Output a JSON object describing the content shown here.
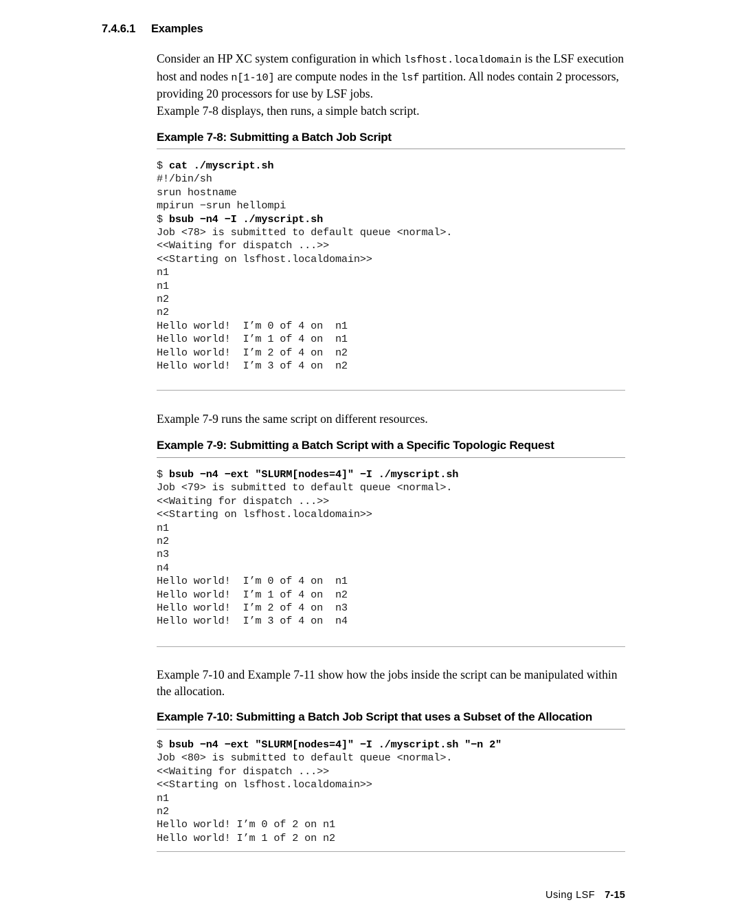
{
  "section": {
    "number": "7.4.6.1",
    "title": "Examples"
  },
  "intro": {
    "paragraph1_part1": "Consider an HP XC system configuration in which ",
    "paragraph1_mono1": "lsfhost.localdomain",
    "paragraph1_part2": " is the LSF execution host and nodes ",
    "paragraph1_mono2": "n[1-10]",
    "paragraph1_part3": " are compute nodes in the ",
    "paragraph1_mono3": "lsf",
    "paragraph1_part4": " partition. All nodes contain 2 processors, providing 20 processors for use by LSF jobs.",
    "paragraph2": "Example 7-8 displays, then runs, a simple batch script."
  },
  "example_7_8": {
    "title": "Example 7-8: Submitting a Batch Job Script",
    "lines": [
      {
        "prompt": "$ ",
        "command": "cat ./myscript.sh",
        "bold": true
      },
      {
        "prompt": "",
        "command": "#!/bin/sh",
        "bold": false
      },
      {
        "prompt": "",
        "command": "srun hostname",
        "bold": false
      },
      {
        "prompt": "",
        "command": "mpirun −srun hellompi",
        "bold": false
      },
      {
        "prompt": "$ ",
        "command": "bsub −n4 −I ./myscript.sh",
        "bold": true
      },
      {
        "prompt": "",
        "command": "Job <78> is submitted to default queue <normal>.",
        "bold": false
      },
      {
        "prompt": "",
        "command": "<<Waiting for dispatch ...>>",
        "bold": false
      },
      {
        "prompt": "",
        "command": "<<Starting on lsfhost.localdomain>>",
        "bold": false
      },
      {
        "prompt": "",
        "command": "n1",
        "bold": false
      },
      {
        "prompt": "",
        "command": "n1",
        "bold": false
      },
      {
        "prompt": "",
        "command": "n2",
        "bold": false
      },
      {
        "prompt": "",
        "command": "n2",
        "bold": false
      },
      {
        "prompt": "",
        "command": "Hello world!  I’m 0 of 4 on  n1",
        "bold": false
      },
      {
        "prompt": "",
        "command": "Hello world!  I’m 1 of 4 on  n1",
        "bold": false
      },
      {
        "prompt": "",
        "command": "Hello world!  I’m 2 of 4 on  n2",
        "bold": false
      },
      {
        "prompt": "",
        "command": "Hello world!  I’m 3 of 4 on  n2",
        "bold": false
      }
    ]
  },
  "mid_text_1": "Example 7-9 runs the same script on different resources.",
  "example_7_9": {
    "title": "Example 7-9: Submitting a Batch Script with a Specific Topologic Request",
    "lines": [
      {
        "prompt": "$ ",
        "command": "bsub −n4 −ext \"SLURM[nodes=4]\" −I ./myscript.sh",
        "bold": true
      },
      {
        "prompt": "",
        "command": "Job <79> is submitted to default queue <normal>.",
        "bold": false
      },
      {
        "prompt": "",
        "command": "<<Waiting for dispatch ...>>",
        "bold": false
      },
      {
        "prompt": "",
        "command": "<<Starting on lsfhost.localdomain>>",
        "bold": false
      },
      {
        "prompt": "",
        "command": "n1",
        "bold": false
      },
      {
        "prompt": "",
        "command": "n2",
        "bold": false
      },
      {
        "prompt": "",
        "command": "n3",
        "bold": false
      },
      {
        "prompt": "",
        "command": "n4",
        "bold": false
      },
      {
        "prompt": "",
        "command": "Hello world!  I’m 0 of 4 on  n1",
        "bold": false
      },
      {
        "prompt": "",
        "command": "Hello world!  I’m 1 of 4 on  n2",
        "bold": false
      },
      {
        "prompt": "",
        "command": "Hello world!  I’m 2 of 4 on  n3",
        "bold": false
      },
      {
        "prompt": "",
        "command": "Hello world!  I’m 3 of 4 on  n4",
        "bold": false
      }
    ]
  },
  "mid_text_2": "Example 7-10 and Example 7-11 show how the jobs inside the script can be manipulated within the allocation.",
  "example_7_10": {
    "title": "Example 7-10: Submitting a Batch Job Script that uses a Subset of the Allocation",
    "lines": [
      {
        "prompt": "$ ",
        "command": "bsub −n4 −ext \"SLURM[nodes=4]\" −I ./myscript.sh \"−n 2\"",
        "bold": true
      },
      {
        "prompt": "",
        "command": "Job <80> is submitted to default queue <normal>.",
        "bold": false
      },
      {
        "prompt": "",
        "command": "<<Waiting for dispatch ...>>",
        "bold": false
      },
      {
        "prompt": "",
        "command": "<<Starting on lsfhost.localdomain>>",
        "bold": false
      },
      {
        "prompt": "",
        "command": "n1",
        "bold": false
      },
      {
        "prompt": "",
        "command": "n2",
        "bold": false
      },
      {
        "prompt": "",
        "command": "Hello world! I’m 0 of 2 on n1",
        "bold": false
      },
      {
        "prompt": "",
        "command": "Hello world! I’m 1 of 2 on n2",
        "bold": false
      }
    ]
  },
  "footer": {
    "label": "Using LSF",
    "page": "7-15"
  }
}
